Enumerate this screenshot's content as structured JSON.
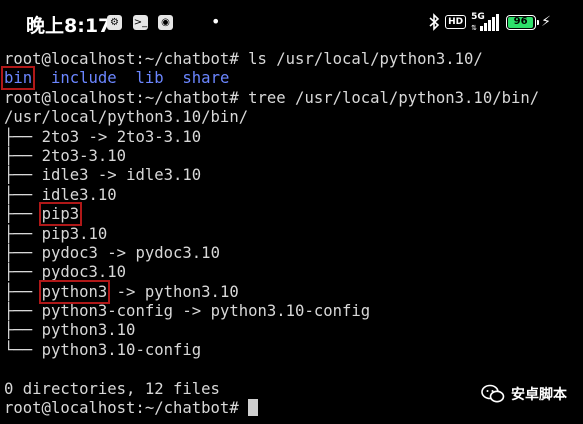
{
  "status_bar": {
    "time": "晚上8:17",
    "network_type": "5G",
    "battery_level": "96",
    "icons": [
      "settings-app-icon",
      "terminal-app-icon",
      "camera-app-icon",
      "notification-dot-icon",
      "bluetooth-icon",
      "hd-icon",
      "signal-icon",
      "battery-icon",
      "charging-bolt-icon"
    ]
  },
  "terminal": {
    "prompt": "root@localhost:~/chatbot#",
    "command_ls": "ls /usr/local/python3.10/",
    "ls_output": [
      "bin",
      "include",
      "lib",
      "share"
    ],
    "command_tree": "tree /usr/local/python3.10/bin/",
    "tree_root": "/usr/local/python3.10/bin/",
    "tree_entries": [
      {
        "branch": "├── ",
        "name": "2to3",
        "target": "2to3-3.10"
      },
      {
        "branch": "├── ",
        "name": "2to3-3.10",
        "target": ""
      },
      {
        "branch": "├── ",
        "name": "idle3",
        "target": "idle3.10"
      },
      {
        "branch": "├── ",
        "name": "idle3.10",
        "target": ""
      },
      {
        "branch": "├── ",
        "name": "pip3",
        "target": "",
        "highlighted": true
      },
      {
        "branch": "├── ",
        "name": "pip3.10",
        "target": ""
      },
      {
        "branch": "├── ",
        "name": "pydoc3",
        "target": "pydoc3.10"
      },
      {
        "branch": "├── ",
        "name": "pydoc3.10",
        "target": ""
      },
      {
        "branch": "├── ",
        "name": "python3",
        "target": "python3.10",
        "highlighted": true
      },
      {
        "branch": "├── ",
        "name": "python3-config",
        "target": "python3.10-config"
      },
      {
        "branch": "├── ",
        "name": "python3.10",
        "target": ""
      },
      {
        "branch": "└── ",
        "name": "python3.10-config",
        "target": ""
      }
    ],
    "arrow": " -> ",
    "summary": "0 directories, 12 files"
  },
  "watermark": {
    "text": "安卓脚本",
    "icon": "wechat-icon"
  },
  "colors": {
    "background": "#000000",
    "text": "#d8d8d8",
    "directory": "#6b86ff",
    "highlight_box": "#b01818",
    "battery": "#2ee06b"
  }
}
